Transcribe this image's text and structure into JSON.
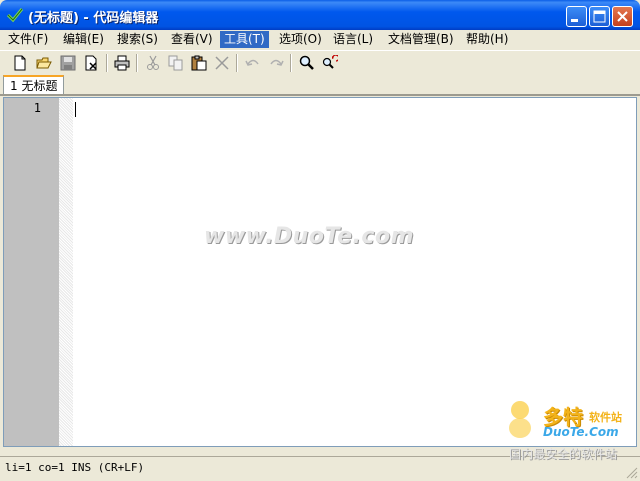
{
  "window": {
    "title": "(无标题) - 代码编辑器",
    "buttons": [
      "minimize",
      "maximize",
      "close"
    ]
  },
  "menu": [
    {
      "label": "文件(F)",
      "name": "file"
    },
    {
      "label": "编辑(E)",
      "name": "edit"
    },
    {
      "label": "搜索(S)",
      "name": "search"
    },
    {
      "label": "查看(V)",
      "name": "view"
    },
    {
      "label": "工具(T)",
      "name": "tools",
      "active": true
    },
    {
      "label": "选项(O)",
      "name": "options"
    },
    {
      "label": "语言(L)",
      "name": "language"
    },
    {
      "label": "文档管理(B)",
      "name": "document-manager"
    },
    {
      "label": "帮助(H)",
      "name": "help"
    }
  ],
  "toolbar": {
    "icons": [
      "new-file-icon",
      "open-folder-icon",
      "save-icon",
      "close-file-icon",
      "print-icon",
      "cut-icon",
      "copy-icon",
      "paste-icon",
      "delete-icon",
      "undo-icon",
      "redo-icon",
      "find-icon",
      "replace-icon"
    ]
  },
  "tabs": [
    {
      "number": "1",
      "label": "无标题",
      "active": true
    }
  ],
  "editor": {
    "line_numbers": [
      "1"
    ],
    "content": "",
    "watermark": "www.DuoTe.com"
  },
  "status": {
    "text": "li=1 co=1 INS (CR+LF)"
  },
  "logo": {
    "cn": "多特",
    "cn_small": "软件站",
    "en": "DuoTe.Com",
    "tagline": "国内最安全的软件站"
  },
  "colors": {
    "titlebar": "#0054e3",
    "menu_highlight": "#316ac5",
    "gutter": "#c0c0c0",
    "tab_accent": "#f7a526"
  }
}
